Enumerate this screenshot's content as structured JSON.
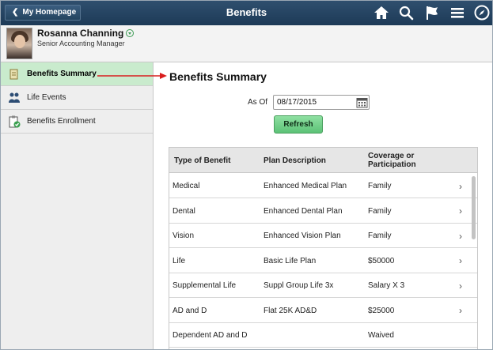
{
  "header": {
    "home_label": "My Homepage",
    "title": "Benefits",
    "icons": [
      "home-icon",
      "search-icon",
      "flag-icon",
      "menu-icon",
      "navbar-compass-icon"
    ]
  },
  "profile": {
    "name": "Rosanna Channing",
    "job_title": "Senior Accounting Manager"
  },
  "sidebar": {
    "items": [
      {
        "label": "Benefits Summary",
        "icon": "benefits-summary-icon",
        "active": true
      },
      {
        "label": "Life Events",
        "icon": "life-events-icon",
        "active": false
      },
      {
        "label": "Benefits Enrollment",
        "icon": "benefits-enrollment-icon",
        "active": false
      }
    ]
  },
  "main": {
    "title": "Benefits Summary",
    "as_of_label": "As Of",
    "as_of_value": "08/17/2015",
    "refresh_label": "Refresh"
  },
  "table": {
    "columns": [
      "Type of Benefit",
      "Plan Description",
      "Coverage or Participation"
    ],
    "rows": [
      {
        "type": "Medical",
        "plan": "Enhanced Medical Plan",
        "coverage": "Family"
      },
      {
        "type": "Dental",
        "plan": "Enhanced Dental Plan",
        "coverage": "Family"
      },
      {
        "type": "Vision",
        "plan": "Enhanced Vision Plan",
        "coverage": "Family"
      },
      {
        "type": "Life",
        "plan": "Basic Life Plan",
        "coverage": "$50000"
      },
      {
        "type": "Supplemental Life",
        "plan": "Suppl Group Life 3x",
        "coverage": "Salary X 3"
      },
      {
        "type": "AD and D",
        "plan": "Flat 25K AD&D",
        "coverage": "$25000"
      },
      {
        "type": "Dependent AD and D",
        "plan": "",
        "coverage": "Waived"
      }
    ]
  },
  "colors": {
    "header_bg": "#1d3a57",
    "active_item_bg": "#c9ebcd",
    "refresh_bg": "#5cc277",
    "annotation_arrow": "#d91e1e"
  }
}
